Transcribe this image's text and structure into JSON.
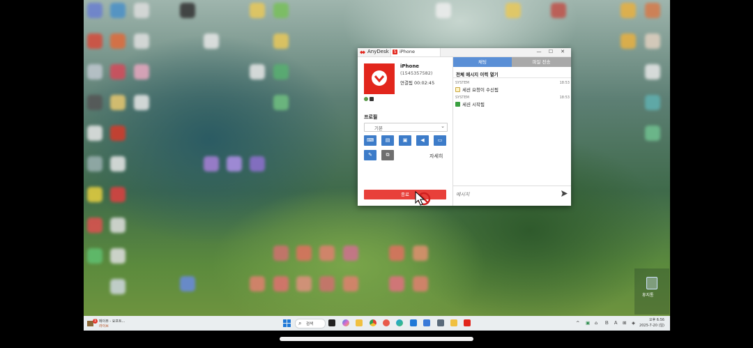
{
  "anydesk": {
    "app_title": "AnyDesk",
    "tab_label": "iPhone",
    "tab_icon": "anydesk-session-icon",
    "window_controls": [
      "—",
      "☐",
      "✕"
    ],
    "device": {
      "name": "iPhone",
      "id": "(1545357582)",
      "connection_time": "연결됨 00:02:45"
    },
    "profile": {
      "label": "프로필",
      "selected": "기본"
    },
    "tools": {
      "icons": [
        "input-control-icon",
        "file-icon",
        "clipboard-icon",
        "audio-icon",
        "screen-icon",
        "draw-icon",
        "window-icon"
      ],
      "details_label": "자세히"
    },
    "end_button_label": "종료",
    "chat": {
      "tab_chat": "채팅",
      "tab_file": "파일 전송",
      "history_link": "전체 메시지 이력 열기",
      "messages": [
        {
          "sender": "SYSTEM",
          "time": "18:53",
          "text": "세션 요청이 수신됨",
          "icon": "session-request-icon"
        },
        {
          "sender": "SYSTEM",
          "time": "18:53",
          "text": "세션 시작됨",
          "icon": "session-start-icon"
        }
      ],
      "input_placeholder": "메시지"
    }
  },
  "desktop": {
    "recycle_bin_label": "휴지통"
  },
  "taskbar": {
    "notification": {
      "badge": "1",
      "title": "메이뷰 - 요프트...",
      "subtitle": "라이브"
    },
    "search_label": "검색",
    "apps": [
      "task-view-icon",
      "copilot-icon",
      "file-explorer-icon",
      "chrome-icon",
      "photos-icon",
      "edge-icon",
      "store-icon",
      "notepad-icon",
      "calculator-icon",
      "onenote-icon",
      "anydesk-icon"
    ],
    "tray": [
      "^",
      "▣",
      "⌂",
      "Ｂ",
      "Ａ",
      "⊞",
      "◈",
      "🔋"
    ],
    "time": "오후 6:56",
    "date": "2025-7-20 (일)"
  },
  "colors": {
    "anydesk_red": "#e2261c",
    "tool_blue": "#3d7cc9",
    "chat_tab_blue": "#5a8fd6",
    "end_red": "#e8403a"
  }
}
